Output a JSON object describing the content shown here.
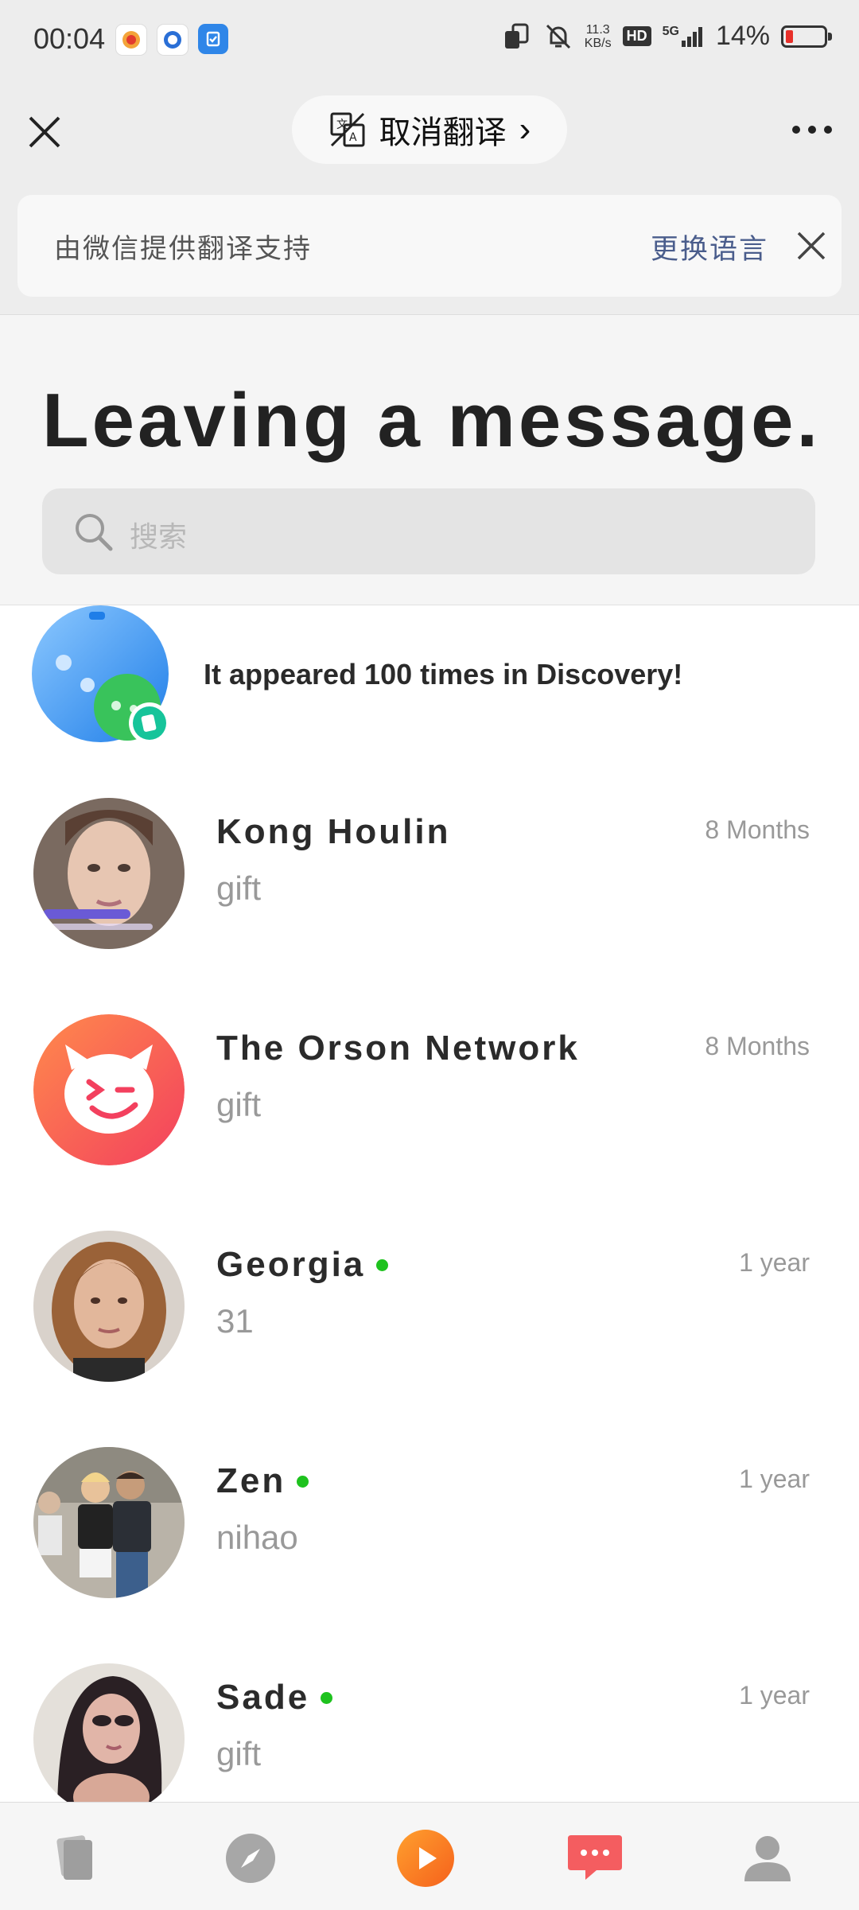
{
  "status_bar": {
    "time": "00:04",
    "net_speed_value": "11.3",
    "net_speed_unit": "KB/s",
    "hd": "HD",
    "network": "5G",
    "battery": "14%"
  },
  "nav": {
    "translate_label": "取消翻译",
    "translate_chevron": "›"
  },
  "banner": {
    "text": "由微信提供翻译支持",
    "change_language": "更换语言"
  },
  "page": {
    "title": "Leaving a message.",
    "search_placeholder": "搜索"
  },
  "discovery": {
    "text": "It appeared 100 times in Discovery!"
  },
  "conversations": [
    {
      "name": "Kong Houlin",
      "preview": "gift",
      "time": "8 Months"
    },
    {
      "name": "The Orson Network",
      "preview": "gift",
      "time": "8 Months"
    },
    {
      "name": "Georgia",
      "preview": "31",
      "time": "1 year"
    },
    {
      "name": "Zen",
      "preview": "nihao",
      "time": "1 year"
    },
    {
      "name": "Sade",
      "preview": "gift",
      "time": "1 year"
    }
  ],
  "colors": {
    "accent_orange": "#f7751e",
    "chat_red": "#f45d60",
    "online_green": "#1ec21e",
    "link_blue": "#4a5d8c"
  },
  "tabs": [
    "cards-icon",
    "compass-icon",
    "play-icon",
    "chat-icon",
    "profile-icon"
  ]
}
